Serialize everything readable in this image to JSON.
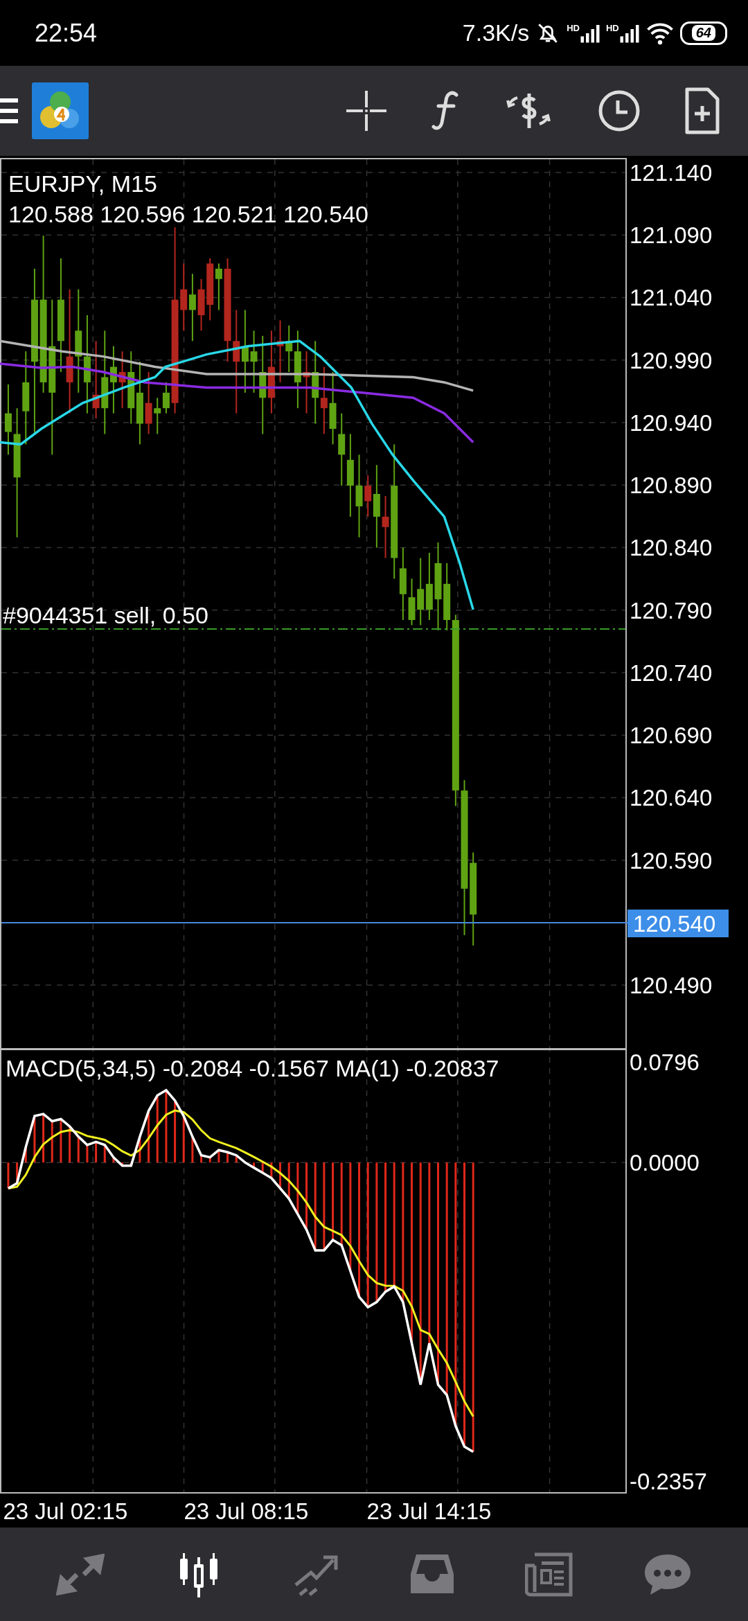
{
  "status_bar": {
    "time": "22:54",
    "net_speed": "7.3K/s",
    "signal_labels": [
      "HD",
      "HD"
    ],
    "battery": "64"
  },
  "chart": {
    "symbol": "EURJPY, M15",
    "ohlc": "120.588 120.596 120.521 120.540",
    "order_label": "#9044351 sell, 0.50",
    "price_axis": [
      "121.140",
      "121.090",
      "121.040",
      "120.990",
      "120.940",
      "120.890",
      "120.840",
      "120.790",
      "120.740",
      "120.690",
      "120.640",
      "120.590",
      "120.490"
    ],
    "current_price": "120.540",
    "macd_label": "MACD(5,34,5) -0.2084 -0.1567 MA(1) -0.20837",
    "macd_axis": [
      "0.0796",
      "0.0000",
      "-0.2357"
    ],
    "time_axis": [
      "23 Jul 02:15",
      "23 Jul 08:15",
      "23 Jul 14:15"
    ]
  },
  "bottom_nav": [
    {
      "kind": "trade",
      "selected": false
    },
    {
      "kind": "chart",
      "selected": true
    },
    {
      "kind": "history",
      "selected": false
    },
    {
      "kind": "inbox",
      "selected": false
    },
    {
      "kind": "news",
      "selected": false
    },
    {
      "kind": "chat",
      "selected": false
    }
  ]
}
